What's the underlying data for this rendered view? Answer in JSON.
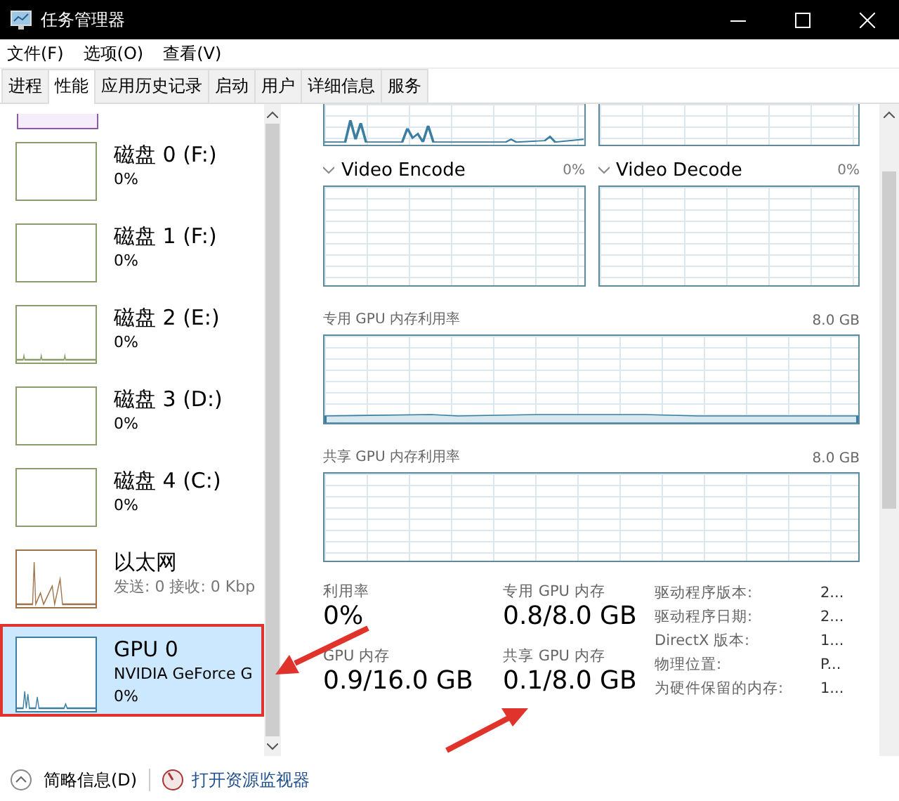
{
  "window": {
    "title": "任务管理器"
  },
  "menu": [
    "文件(F)",
    "选项(O)",
    "查看(V)"
  ],
  "tabs": [
    {
      "label": "进程",
      "selected": false
    },
    {
      "label": "性能",
      "selected": true
    },
    {
      "label": "应用历史记录",
      "selected": false
    },
    {
      "label": "启动",
      "selected": false
    },
    {
      "label": "用户",
      "selected": false
    },
    {
      "label": "详细信息",
      "selected": false
    },
    {
      "label": "服务",
      "selected": false
    }
  ],
  "sidebar": {
    "items": [
      {
        "kind": "disk",
        "name": "磁盘 0 (F:)",
        "lines": [
          "0%"
        ],
        "selected": false
      },
      {
        "kind": "disk",
        "name": "磁盘 1 (F:)",
        "lines": [
          "0%"
        ],
        "selected": false
      },
      {
        "kind": "disk",
        "name": "磁盘 2 (E:)",
        "lines": [
          "0%"
        ],
        "selected": false
      },
      {
        "kind": "disk",
        "name": "磁盘 3 (D:)",
        "lines": [
          "0%"
        ],
        "selected": false
      },
      {
        "kind": "disk",
        "name": "磁盘 4 (C:)",
        "lines": [
          "0%"
        ],
        "selected": false
      },
      {
        "kind": "network",
        "name": "以太网",
        "lines": [
          "发送: 0 接收: 0 Kbp"
        ],
        "selected": false
      },
      {
        "kind": "gpu",
        "name": "GPU 0",
        "lines": [
          "NVIDIA GeForce G",
          "0%"
        ],
        "selected": true
      }
    ]
  },
  "engines": [
    {
      "label": "Video Encode",
      "value": "0%"
    },
    {
      "label": "Video Decode",
      "value": "0%"
    }
  ],
  "memory_graphs": [
    {
      "label": "专用 GPU 内存利用率",
      "max": "8.0 GB"
    },
    {
      "label": "共享 GPU 内存利用率",
      "max": "8.0 GB"
    }
  ],
  "stats": [
    {
      "label": "利用率",
      "value": "0%"
    },
    {
      "label": "专用 GPU 内存",
      "value": "0.8/8.0 GB"
    },
    {
      "label": "GPU 内存",
      "value": "0.9/16.0 GB"
    },
    {
      "label": "共享 GPU 内存",
      "value": "0.1/8.0 GB"
    }
  ],
  "details": [
    {
      "label": "驱动程序版本:",
      "value": "2..."
    },
    {
      "label": "驱动程序日期:",
      "value": "2..."
    },
    {
      "label": "DirectX 版本:",
      "value": "1..."
    },
    {
      "label": "物理位置:",
      "value": "P..."
    },
    {
      "label": "为硬件保留的内存:",
      "value": "1..."
    }
  ],
  "footer": {
    "summary": "简略信息(D)",
    "monitor": "打开资源监视器"
  }
}
